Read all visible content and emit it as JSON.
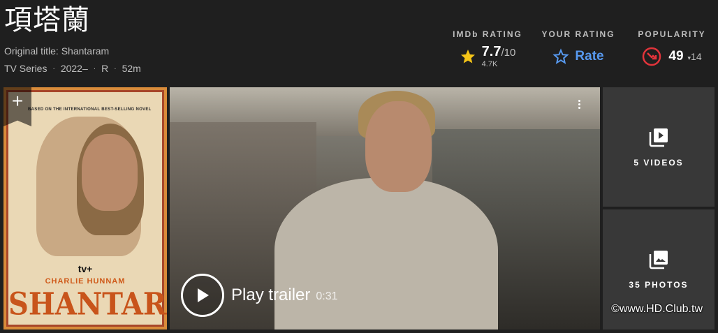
{
  "header": {
    "title": "項塔蘭",
    "original_title": "Original title: Shantaram",
    "meta": [
      "TV Series",
      "2022–",
      "R",
      "52m"
    ]
  },
  "ratings": {
    "imdb": {
      "label": "IMDb RATING",
      "value": "7.7",
      "out_of": "/10",
      "count": "4.7K"
    },
    "yours": {
      "label": "YOUR RATING",
      "action": "Rate"
    },
    "popularity": {
      "label": "POPULARITY",
      "rank": "49",
      "delta": "14"
    }
  },
  "poster": {
    "tagline": "BASED ON THE INTERNATIONAL BEST-SELLING NOVEL",
    "network": "tv+",
    "actor": "CHARLIE HUNNAM",
    "logo": "SHANTARAM"
  },
  "video": {
    "play_label": "Play trailer",
    "duration": "0:31"
  },
  "media_tiles": {
    "videos": "5 VIDEOS",
    "photos": "35 PHOTOS"
  },
  "watermark": "©www.HD.Club.tw",
  "colors": {
    "accent_blue": "#5799ef",
    "star_gold": "#f5c518",
    "popularity_red": "#e2343b"
  }
}
